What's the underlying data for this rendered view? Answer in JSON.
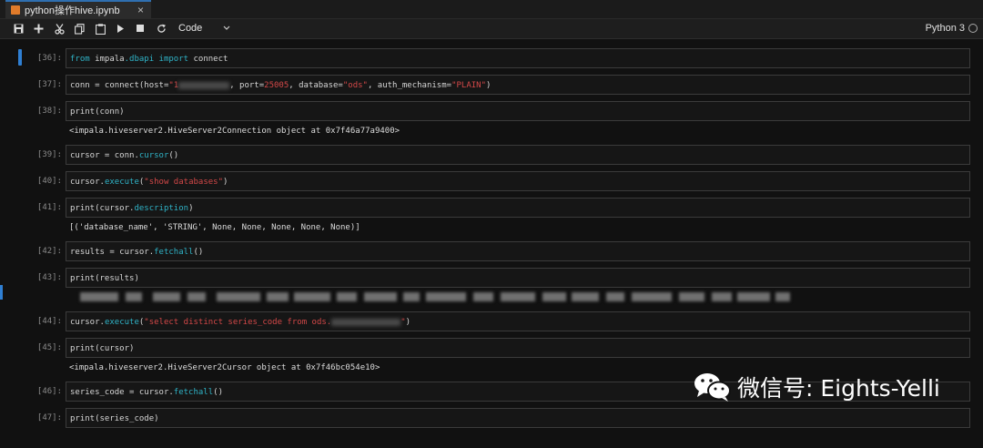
{
  "tab": {
    "title": "python操作hive.ipynb",
    "close_glyph": "×"
  },
  "toolbar": {
    "cell_type": "Code",
    "kernel": "Python 3",
    "buttons": [
      "save-icon",
      "add-cell-icon",
      "cut-icon",
      "copy-icon",
      "paste-icon",
      "run-icon",
      "stop-icon",
      "restart-icon"
    ]
  },
  "cells": [
    {
      "prompt": "[36]:",
      "code": [
        [
          "kw",
          "from "
        ],
        [
          "fn",
          "impala"
        ],
        [
          "kw",
          ".dbapi "
        ],
        [
          "kw",
          "import "
        ],
        [
          "fn",
          "connect"
        ]
      ]
    },
    {
      "prompt": "[37]:",
      "code": [
        [
          "fn",
          "conn = connect(host="
        ],
        [
          "str",
          "\"1"
        ],
        [
          "blur",
          ""
        ],
        [
          "fn",
          ", port="
        ],
        [
          "str",
          "25005"
        ],
        [
          "fn",
          ", database="
        ],
        [
          "str",
          "\"ods\""
        ],
        [
          "fn",
          ", auth_mechanism="
        ],
        [
          "str",
          "\"PLAIN\""
        ],
        [
          "fn",
          ")"
        ]
      ]
    },
    {
      "prompt": "[38]:",
      "code": [
        [
          "fn",
          "print(conn)"
        ]
      ],
      "output": "<impala.hiveserver2.HiveServer2Connection object at 0x7f46a77a9400>"
    },
    {
      "prompt": "[39]:",
      "code": [
        [
          "fn",
          "cursor = conn."
        ],
        [
          "kw",
          "cursor"
        ],
        [
          "fn",
          "()"
        ]
      ]
    },
    {
      "prompt": "[40]:",
      "code": [
        [
          "fn",
          "cursor."
        ],
        [
          "kw",
          "execute"
        ],
        [
          "fn",
          "("
        ],
        [
          "str",
          "\"show databases\""
        ],
        [
          "fn",
          ")"
        ]
      ]
    },
    {
      "prompt": "[41]:",
      "code": [
        [
          "fn",
          "print(cursor."
        ],
        [
          "kw",
          "description"
        ],
        [
          "fn",
          ")"
        ]
      ],
      "output": "[('database_name', 'STRING', None, None, None, None, None)]"
    },
    {
      "prompt": "[42]:",
      "code": [
        [
          "fn",
          "results = cursor."
        ],
        [
          "kw",
          "fetchall"
        ],
        [
          "fn",
          "()"
        ]
      ]
    },
    {
      "prompt": "[43]:",
      "code": [
        [
          "fn",
          "print(results)"
        ]
      ],
      "output_blurred": true
    },
    {
      "prompt": "[44]:",
      "code": [
        [
          "fn",
          "cursor."
        ],
        [
          "kw",
          "execute"
        ],
        [
          "fn",
          "("
        ],
        [
          "str",
          "\"select distinct series_code from ods."
        ],
        [
          "blur",
          ""
        ],
        [
          "str",
          "\""
        ],
        [
          "fn",
          ")"
        ]
      ]
    },
    {
      "prompt": "[45]:",
      "code": [
        [
          "fn",
          "print(cursor)"
        ]
      ],
      "output": "<impala.hiveserver2.HiveServer2Cursor object at 0x7f46bc054e10>"
    },
    {
      "prompt": "[46]:",
      "code": [
        [
          "fn",
          "series_code = cursor."
        ],
        [
          "kw",
          "fetchall"
        ],
        [
          "fn",
          "()"
        ]
      ]
    },
    {
      "prompt": "[47]:",
      "code": [
        [
          "fn",
          "print(series_code)"
        ]
      ]
    }
  ],
  "watermark": {
    "text": "微信号: Eights-Yelli",
    "icon": "wechat-icon"
  },
  "colors": {
    "keyword": "#2fb3c7",
    "string": "#d34848",
    "accent": "#2f7fd3"
  }
}
